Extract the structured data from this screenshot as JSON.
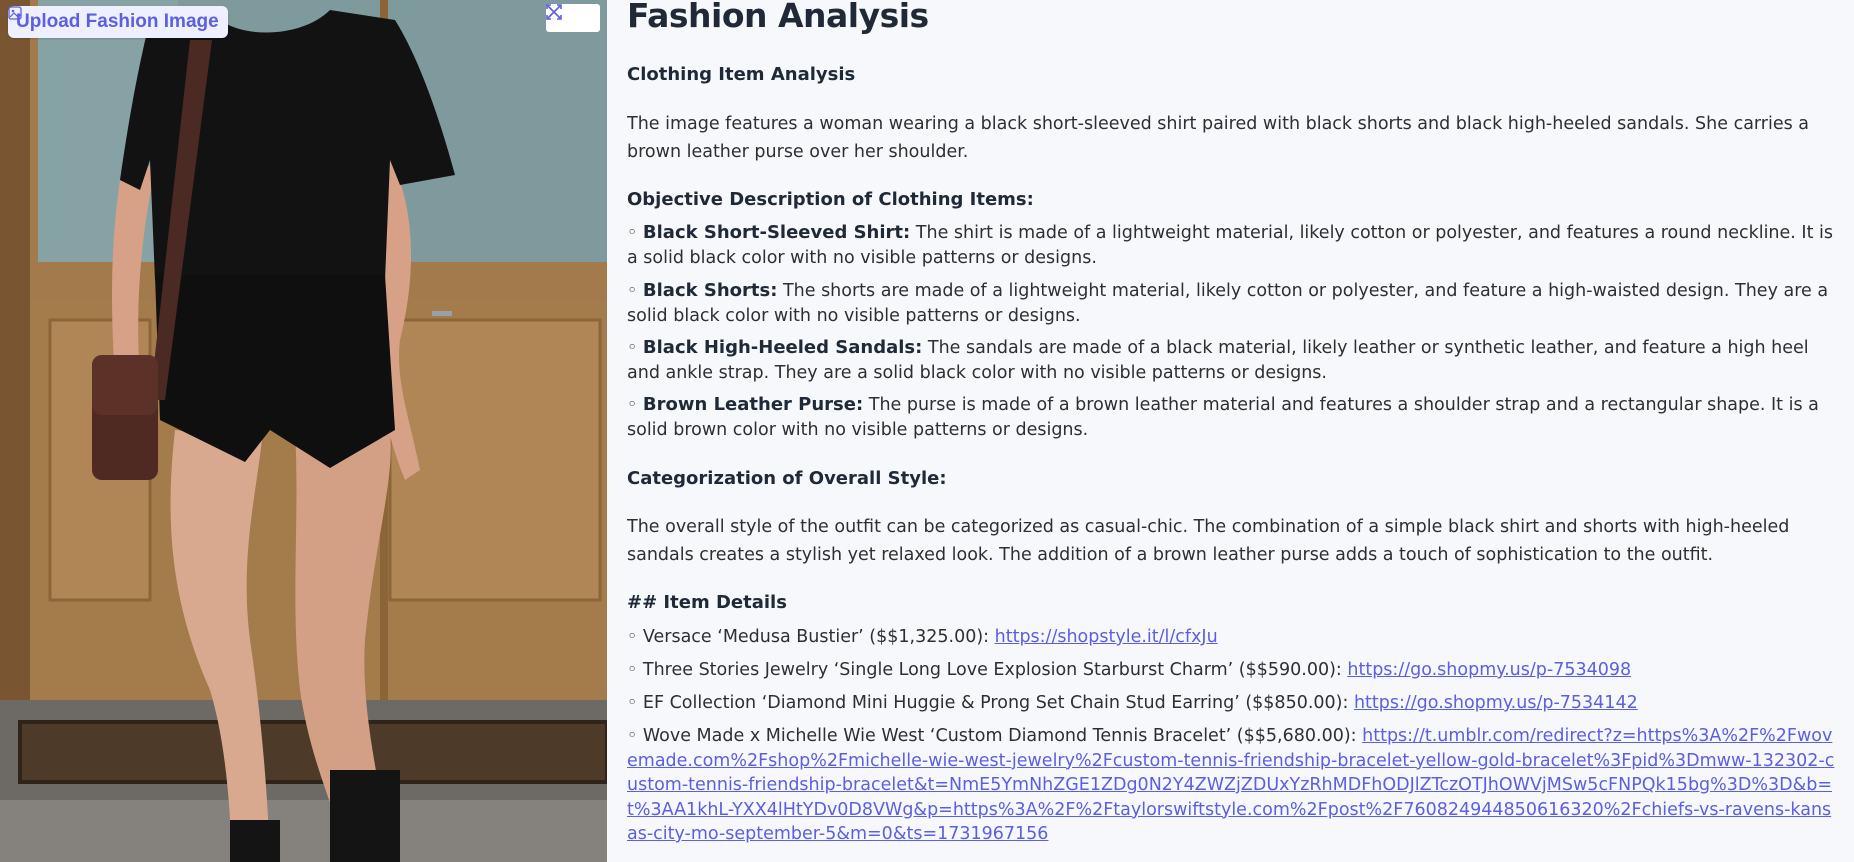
{
  "image_panel": {
    "upload_label": "Upload Fashion Image",
    "icons": {
      "upload": "image-icon",
      "fullscreen": "fullscreen-icon",
      "close": "close-icon"
    }
  },
  "analysis": {
    "title": "Fashion Analysis",
    "clothing_heading": "Clothing Item Analysis",
    "intro": "The image features a woman wearing a black short-sleeved shirt paired with black shorts and black high-heeled sandals. She carries a brown leather purse over her shoulder.",
    "objective_heading": "Objective Description of Clothing Items:",
    "items": [
      {
        "bullet": "◦",
        "name": "Black Short-Sleeved Shirt:",
        "desc": " The shirt is made of a lightweight material, likely cotton or polyester, and features a round neckline. It is a solid black color with no visible patterns or designs."
      },
      {
        "bullet": "◦",
        "name": "Black Shorts:",
        "desc": " The shorts are made of a lightweight material, likely cotton or polyester, and feature a high-waisted design. They are a solid black color with no visible patterns or designs."
      },
      {
        "bullet": "◦",
        "name": "Black High-Heeled Sandals:",
        "desc": " The sandals are made of a black material, likely leather or synthetic leather, and feature a high heel and ankle strap. They are a solid black color with no visible patterns or designs."
      },
      {
        "bullet": "◦",
        "name": "Brown Leather Purse:",
        "desc": " The purse is made of a brown leather material and features a shoulder strap and a rectangular shape. It is a solid brown color with no visible patterns or designs."
      }
    ],
    "style_heading": "Categorization of Overall Style:",
    "style_text": "The overall style of the outfit can be categorized as casual-chic. The combination of a simple black shirt and shorts with high-heeled sandals creates a stylish yet relaxed look. The addition of a brown leather purse adds a touch of sophistication to the outfit.",
    "details_heading": "## Item Details",
    "details": [
      {
        "text": "◦ Versace ‘Medusa Bustier’ ($$1,325.00): ",
        "url": "https://shopstyle.it/l/cfxJu"
      },
      {
        "text": "◦ Three Stories Jewelry ‘Single Long Love Explosion Starburst Charm’ ($$590.00): ",
        "url": "https://go.shopmy.us/p-7534098"
      },
      {
        "text": "◦ EF Collection ‘Diamond Mini Huggie & Prong Set Chain Stud Earring’ ($$850.00): ",
        "url": "https://go.shopmy.us/p-7534142"
      },
      {
        "text": "◦ Wove Made x Michelle Wie West ‘Custom Diamond Tennis Bracelet’ ($$5,680.00): ",
        "url": "https://t.umblr.com/redirect?z=https%3A%2F%2Fwovemade.com%2Fshop%2Fmichelle-wie-west-jewelry%2Fcustom-tennis-friendship-bracelet-yellow-gold-bracelet%3Fpid%3Dmww-132302-custom-tennis-friendship-bracelet&t=NmE5YmNhZGE1ZDg0N2Y4ZWZjZDUxYzRhMDFhODJlZTczOTJhOWVjMSw5cFNPQk15bg%3D%3D&b=t%3AA1khL-YXX4lHtYDv0D8VWg&p=https%3A%2F%2Ftaylorswiftstyle.com%2Fpost%2F760824944850616320%2Fchiefs-vs-ravens-kansas-city-mo-september-5&m=0&ts=1731967156"
      }
    ]
  },
  "colors": {
    "accent": "#5b5fe0",
    "text": "#1f2937",
    "background": "#f7f8fb"
  }
}
